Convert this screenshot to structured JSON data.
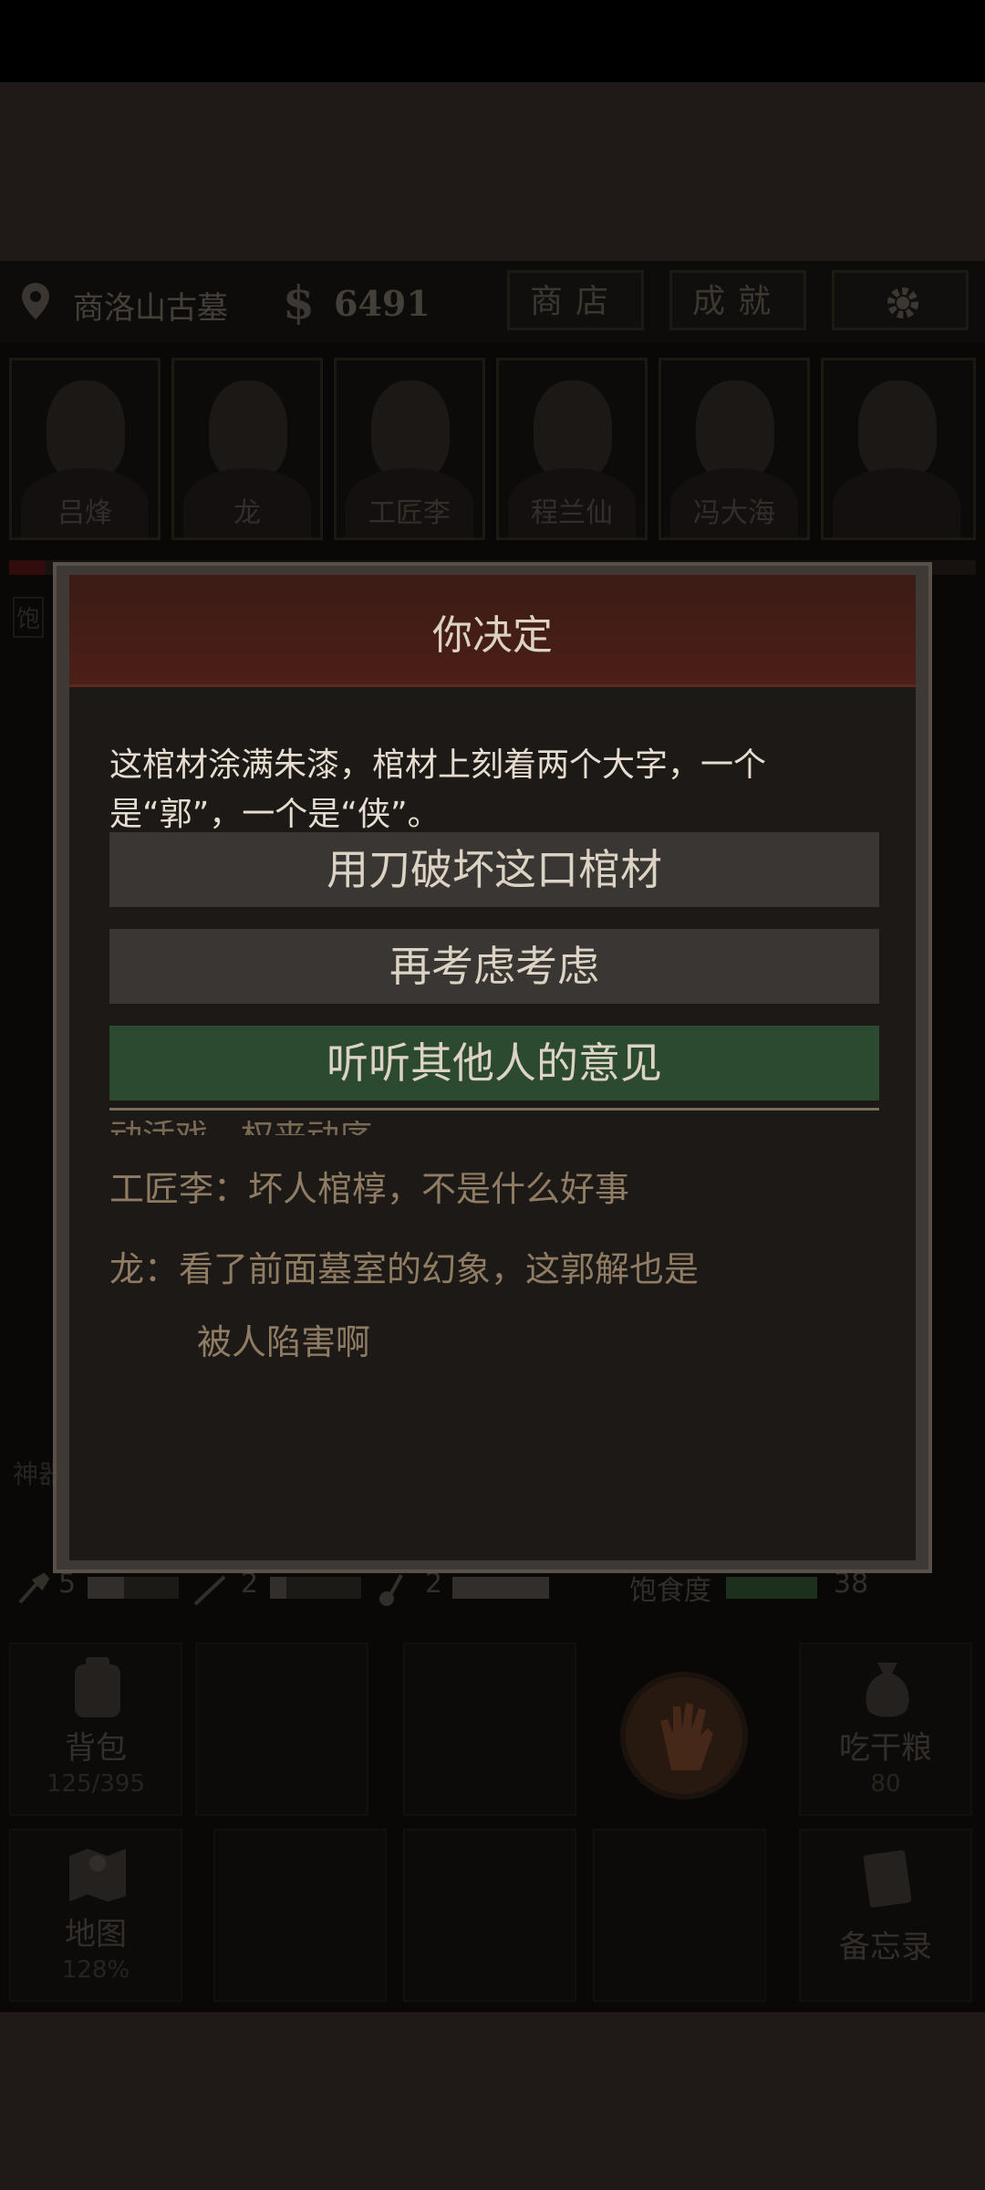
{
  "topbar": {
    "location": "商洛山古墓",
    "money_symbol": "$",
    "money": "6491",
    "shop_label": "商店",
    "achievements_label": "成就",
    "settings_icon": "gear-icon",
    "location_icon": "location-pin-icon"
  },
  "party": [
    {
      "name": "吕烽"
    },
    {
      "name": "龙"
    },
    {
      "name": "工匠李"
    },
    {
      "name": "程兰仙"
    },
    {
      "name": "冯大海"
    },
    {
      "name": ""
    }
  ],
  "side": {
    "tag1": "饱",
    "tag2": "神器"
  },
  "status": {
    "shovel_count": "5",
    "rope_count": "2",
    "ladle_count": "2",
    "satiety_label": "饱食度",
    "satiety_value": "38"
  },
  "grid": {
    "bag_label": "背包",
    "bag_count": "125/395",
    "eat_label": "吃干粮",
    "eat_count": "80",
    "map_label": "地图",
    "map_zoom": "128%",
    "memo_label": "备忘录"
  },
  "dialog": {
    "title": "你决定",
    "text": "这棺材涂满朱漆，棺材上刻着两个大字，一个是“郭”，一个是“侠”。",
    "options": [
      {
        "label": "用刀破坏这口棺材",
        "style": "gray"
      },
      {
        "label": "再考虑考虑",
        "style": "gray"
      },
      {
        "label": "听听其他人的意见",
        "style": "green"
      }
    ],
    "log_cutoff": "动活戏，权来动序",
    "log": [
      {
        "line": "工匠李：坏人棺椁，不是什么好事"
      },
      {
        "line": "龙：看了前面墓室的幻象，这郭解也是"
      },
      {
        "line": "被人陷害啊"
      }
    ]
  },
  "colors": {
    "dialog_header": "#4c1f17",
    "option_gray": "#3a3634",
    "option_green": "#2c4a2f"
  }
}
